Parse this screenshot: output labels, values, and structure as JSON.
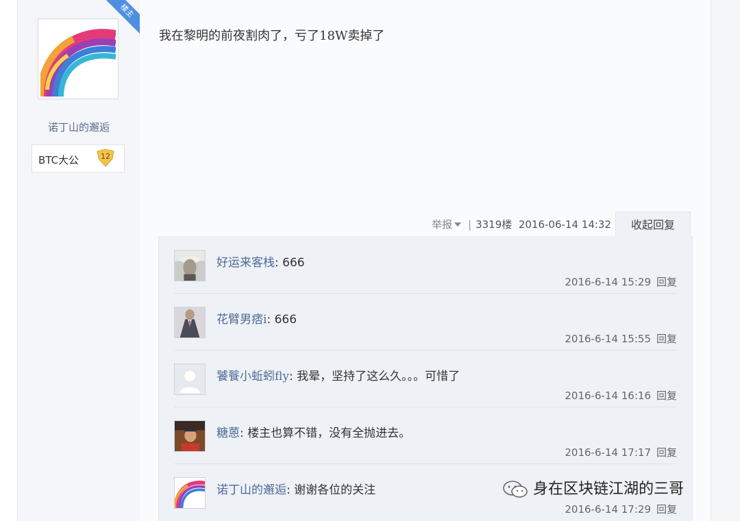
{
  "author": {
    "ribbon_label": "楼主",
    "name": "诺丁山的邂逅",
    "badge_label": "BTC大公",
    "badge_level": "12"
  },
  "post": {
    "text": "我在黎明的前夜割肉了，亏了18W卖掉了",
    "report_label": "举报",
    "separator": "|",
    "floor_num": "3319",
    "floor_suffix": "楼",
    "datetime": "2016-06-14 14:32",
    "collapse_label": "收起回复"
  },
  "replies": [
    {
      "name": "好运来客栈",
      "colon": ": ",
      "text": "666",
      "time": "2016-6-14 15:29",
      "reply_label": "回复",
      "avatar_icon": "man-photo-avatar"
    },
    {
      "name": "花臂男痞i",
      "colon": ": ",
      "text": "666",
      "time": "2016-6-14 15:55",
      "reply_label": "回复",
      "avatar_icon": "suit-photo-avatar"
    },
    {
      "name": "饕餮小蚯蚓fly",
      "colon": ": ",
      "text": "我晕，坚持了这么久。。。可惜了",
      "time": "2016-6-14 16:16",
      "reply_label": "回复",
      "avatar_icon": "default-user-avatar"
    },
    {
      "name": "糖蒽",
      "colon": ": ",
      "text": "楼主也算不错，没有全抛进去。",
      "time": "2016-6-14 17:17",
      "reply_label": "回复",
      "avatar_icon": "person-photo-avatar"
    },
    {
      "name": "诺丁山的邂逅",
      "colon": ": ",
      "text": "谢谢各位的关注",
      "time": "2016-6-14 17:29",
      "reply_label": "回复",
      "avatar_icon": "rainbow-avatar"
    }
  ],
  "watermark": {
    "text": "身在区块链江湖的三哥",
    "icon": "wechat-icon"
  }
}
